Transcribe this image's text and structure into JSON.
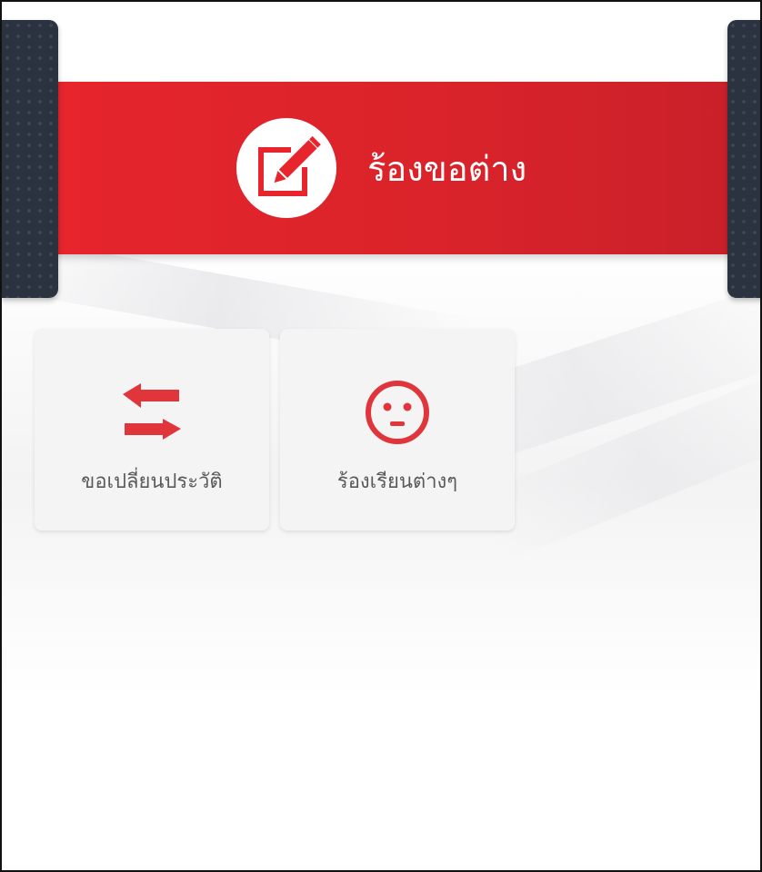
{
  "header": {
    "title": "ร้องขอต่าง",
    "icon": "edit-icon"
  },
  "colors": {
    "accent": "#e8252d",
    "side_tab": "#2b3340",
    "card_bg": "#f4f4f5",
    "label_text": "#5a5a5a"
  },
  "menu": {
    "items": [
      {
        "label": "ขอเปลี่ยนประวัติ",
        "icon": "swap-arrows-icon"
      },
      {
        "label": "ร้องเรียนต่างๆ",
        "icon": "neutral-face-icon"
      }
    ]
  }
}
